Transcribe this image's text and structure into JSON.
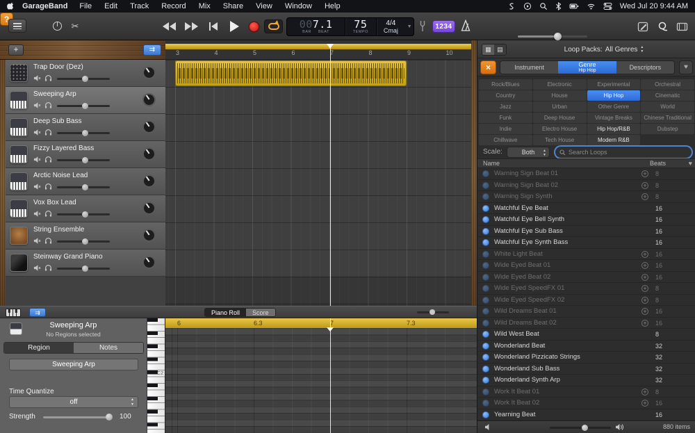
{
  "menu_bar": {
    "app_name": "GarageBand",
    "items": [
      "File",
      "Edit",
      "Track",
      "Record",
      "Mix",
      "Share",
      "View",
      "Window",
      "Help"
    ],
    "status_icons": [
      "shazam-icon",
      "play-circle-icon",
      "search-icon",
      "bluetooth-icon",
      "battery-icon",
      "wifi-icon",
      "control-center-icon"
    ],
    "clock": "Wed Jul 20 9:44 AM"
  },
  "toolbar": {
    "lcd": {
      "bar_pad": "00",
      "bar_beat": "7.1",
      "bar_label": "BAR",
      "beat_label": "BEAT",
      "tempo": "75",
      "tempo_label": "TEMPO",
      "time_sig": "4/4",
      "key": "Cmaj"
    },
    "help_label": "?",
    "count_in_label": "1234",
    "colors": {
      "accent_orange": "#e8882a",
      "accent_purple": "#8a5ce0",
      "record_red": "#d01510",
      "cycle_orange": "#f0a63a"
    }
  },
  "arrange": {
    "add_track_label": "+",
    "catch_label": "⇉",
    "ruler_numbers": [
      "3",
      "4",
      "5",
      "6",
      "7",
      "8",
      "9",
      "10"
    ]
  },
  "tracks": [
    {
      "name": "Trap Door (Dez)",
      "icon": "drum-machine",
      "state": "normal"
    },
    {
      "name": "Sweeping Arp",
      "icon": "synth",
      "state": "selected"
    },
    {
      "name": "Deep Sub Bass",
      "icon": "synth",
      "state": "normal"
    },
    {
      "name": "Fizzy Layered Bass",
      "icon": "synth",
      "state": "normal"
    },
    {
      "name": "Arctic Noise Lead",
      "icon": "synth",
      "state": "normal"
    },
    {
      "name": "Vox Box Lead",
      "icon": "synth",
      "state": "normal"
    },
    {
      "name": "String Ensemble",
      "icon": "strings",
      "state": "normal"
    },
    {
      "name": "Steinway Grand Piano",
      "icon": "piano",
      "state": "normal"
    }
  ],
  "editor": {
    "catch_label": "⇉",
    "tabs": [
      {
        "label": "Piano Roll",
        "state": "selected"
      },
      {
        "label": "Score",
        "state": "normal"
      }
    ],
    "track_name": "Sweeping Arp",
    "status": "No Regions selected",
    "sub_tabs": [
      {
        "label": "Region",
        "state": "selected"
      },
      {
        "label": "Notes",
        "state": "normal"
      }
    ],
    "region_button": "Sweeping Arp",
    "time_quantize_label": "Time Quantize",
    "time_quantize_value": "off",
    "strength_label": "Strength",
    "strength_value": "100",
    "key_label": "C2",
    "ruler_numbers": [
      "6",
      "6.3",
      "7",
      "7.3"
    ]
  },
  "loop_browser": {
    "loop_packs_label": "Loop Packs:",
    "loop_packs_value": "All Genres",
    "close_label": "×",
    "favorites_label": "♥",
    "tabs": [
      {
        "label": "Instrument",
        "state": "normal"
      },
      {
        "label": "Genre",
        "sub": "Hip Hop",
        "state": "selected"
      },
      {
        "label": "Descriptors",
        "state": "normal"
      }
    ],
    "genres": [
      {
        "label": "Rock/Blues",
        "state": "dim"
      },
      {
        "label": "Electronic",
        "state": "dim"
      },
      {
        "label": "Experimental",
        "state": "dim"
      },
      {
        "label": "Orchestral",
        "state": "dim"
      },
      {
        "label": "Country",
        "state": "dim"
      },
      {
        "label": "House",
        "state": "dim"
      },
      {
        "label": "Hip Hop",
        "state": "selected"
      },
      {
        "label": "Cinematic",
        "state": "dim"
      },
      {
        "label": "Jazz",
        "state": "dim"
      },
      {
        "label": "Urban",
        "state": "dim"
      },
      {
        "label": "Other Genre",
        "state": "dim"
      },
      {
        "label": "World",
        "state": "dim"
      },
      {
        "label": "Funk",
        "state": "dim"
      },
      {
        "label": "Deep House",
        "state": "dim"
      },
      {
        "label": "Vintage Breaks",
        "state": "dim"
      },
      {
        "label": "Chinese Traditional",
        "state": "dim"
      },
      {
        "label": "Indie",
        "state": "dim"
      },
      {
        "label": "Electro House",
        "state": "dim"
      },
      {
        "label": "Hip Hop/R&B",
        "state": "bright"
      },
      {
        "label": "Dubstep",
        "state": "dim"
      },
      {
        "label": "Chillwave",
        "state": "dim"
      },
      {
        "label": "Tech House",
        "state": "dim"
      },
      {
        "label": "Modern R&B",
        "state": "bright"
      },
      {
        "label": "",
        "state": "empty"
      }
    ],
    "scale_label": "Scale:",
    "scale_value": "Both",
    "search_placeholder": "Search Loops",
    "columns": {
      "name": "Name",
      "beats": "Beats"
    },
    "rows": [
      {
        "name": "Warning Sign Beat 01",
        "beats": "8",
        "state": "dim"
      },
      {
        "name": "Warning Sign Beat 02",
        "beats": "8",
        "state": "dim"
      },
      {
        "name": "Warning Sign Synth",
        "beats": "8",
        "state": "dim"
      },
      {
        "name": "Watchful Eye Beat",
        "beats": "16",
        "state": "bright"
      },
      {
        "name": "Watchful Eye Bell Synth",
        "beats": "16",
        "state": "bright"
      },
      {
        "name": "Watchful Eye Sub Bass",
        "beats": "16",
        "state": "bright"
      },
      {
        "name": "Watchful Eye Synth Bass",
        "beats": "16",
        "state": "bright"
      },
      {
        "name": "White Light Beat",
        "beats": "16",
        "state": "dim"
      },
      {
        "name": "Wide Eyed Beat 01",
        "beats": "16",
        "state": "dim"
      },
      {
        "name": "Wide Eyed Beat 02",
        "beats": "16",
        "state": "dim"
      },
      {
        "name": "Wide Eyed SpeedFX 01",
        "beats": "8",
        "state": "dim"
      },
      {
        "name": "Wide Eyed SpeedFX 02",
        "beats": "8",
        "state": "dim"
      },
      {
        "name": "Wild Dreams Beat 01",
        "beats": "16",
        "state": "dim"
      },
      {
        "name": "Wild Dreams Beat 02",
        "beats": "16",
        "state": "dim"
      },
      {
        "name": "Wild West Beat",
        "beats": "8",
        "state": "bright"
      },
      {
        "name": "Wonderland Beat",
        "beats": "32",
        "state": "bright"
      },
      {
        "name": "Wonderland Pizzicato Strings",
        "beats": "32",
        "state": "bright"
      },
      {
        "name": "Wonderland Sub Bass",
        "beats": "32",
        "state": "bright"
      },
      {
        "name": "Wonderland Synth Arp",
        "beats": "32",
        "state": "bright"
      },
      {
        "name": "Work It Beat 01",
        "beats": "8",
        "state": "dim"
      },
      {
        "name": "Work It Beat 02",
        "beats": "16",
        "state": "dim"
      },
      {
        "name": "Yearning Beat",
        "beats": "16",
        "state": "bright"
      }
    ],
    "items_count": "880 items"
  }
}
